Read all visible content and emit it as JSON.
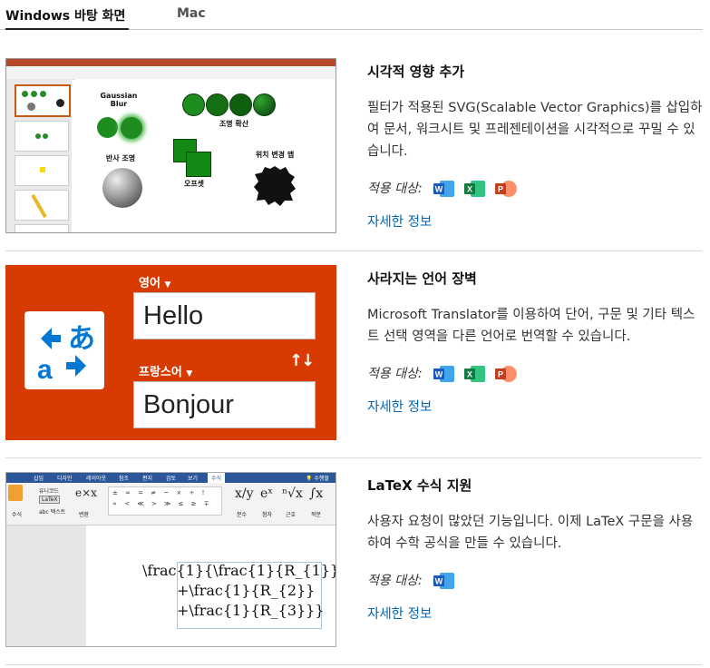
{
  "tabs": {
    "windows": "Windows 바탕 화면",
    "mac": "Mac"
  },
  "features": [
    {
      "title": "시각적 영향 추가",
      "description": "필터가 적용된 SVG(Scalable Vector Graphics)를 삽입하여 문서, 워크시트 및 프레젠테이션을 시각적으로 꾸밀 수 있습니다.",
      "applies_label": "적용 대상:",
      "apps": [
        "word-icon",
        "excel-icon",
        "powerpoint-icon"
      ],
      "learn_more": "자세한 정보"
    },
    {
      "title": "사라지는 언어 장벽",
      "description": "Microsoft Translator를 이용하여 단어, 구문 및 기타 텍스트 선택 영역을 다른 언어로 번역할 수 있습니다.",
      "applies_label": "적용 대상:",
      "apps": [
        "word-icon",
        "excel-icon",
        "powerpoint-icon"
      ],
      "learn_more": "자세한 정보"
    },
    {
      "title": "LaTeX 수식 지원",
      "description": "사용자 요청이 많았던 기능입니다. 이제 LaTeX 구문을 사용하여 수학 공식을 만들 수 있습니다.",
      "applies_label": "적용 대상:",
      "apps": [
        "word-icon"
      ],
      "learn_more": "자세한 정보"
    }
  ],
  "ppt_slide": {
    "gaussian_label": "Gaussian Blur",
    "lighting_label": "조명 확산",
    "reflect_label": "반사 조명",
    "offset_label": "오프셋",
    "displace_label": "위치 변경 맵"
  },
  "translator": {
    "source_lang": "영어",
    "source_text": "Hello",
    "target_lang": "프랑스어",
    "target_text": "Bonjour"
  },
  "word_ui": {
    "menu": [
      "삽입",
      "디자인",
      "레이아웃",
      "참조",
      "편지",
      "검토",
      "보기",
      "수식"
    ],
    "search": "수행할",
    "unicode": "유니코드",
    "latex": "LaTeX",
    "text_opt": "abc 텍스트",
    "equation": "수식",
    "convert": "변환",
    "fraction": "분수",
    "script": "첨자",
    "radical": "근호",
    "integral": "적분",
    "eq_line1": "\\frac{1}{\\frac{1}{R_{1}}",
    "eq_line2": "+\\frac{1}{R_{2}}",
    "eq_line3": "+\\frac{1}{R_{3}}}"
  },
  "colors": {
    "link": "#0067b8",
    "translator_bg": "#d83b01",
    "word_blue": "#2b579a",
    "excel_green": "#217346",
    "ppt_red": "#d24726"
  }
}
